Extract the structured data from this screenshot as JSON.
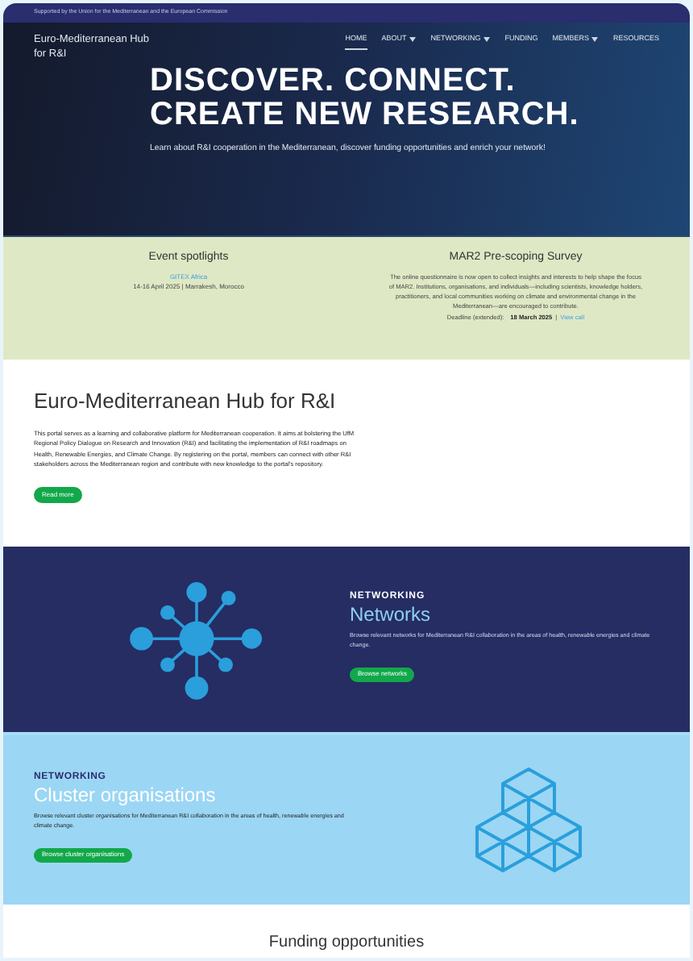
{
  "top_bar": {
    "text": "Supported by the Union for the Mediterranean and the European Commission"
  },
  "header": {
    "logo": "Euro-Mediterranean Hub for R&I",
    "nav": [
      {
        "label": "HOME",
        "selected": true,
        "dropdown": false
      },
      {
        "label": "ABOUT",
        "selected": false,
        "dropdown": true
      },
      {
        "label": "NETWORKING",
        "selected": false,
        "dropdown": true
      },
      {
        "label": "FUNDING",
        "selected": false,
        "dropdown": false
      },
      {
        "label": "MEMBERS",
        "selected": false,
        "dropdown": true
      },
      {
        "label": "RESOURCES",
        "selected": false,
        "dropdown": false
      }
    ]
  },
  "hero": {
    "title_lines": [
      "DISCOVER. CONNECT.",
      "CREATE NEW RESEARCH."
    ],
    "subtitle": "Learn about R&I cooperation in the Mediterranean, discover funding opportunities and enrich your network!"
  },
  "events": {
    "title": "Event spotlights",
    "link": "GITEX Africa",
    "details": "14-16 April 2025 | Marrakesh, Morocco"
  },
  "survey": {
    "title": "MAR2 Pre-scoping Survey",
    "body": "The online questionnaire is now open to collect insights and interests to help shape the focus of MAR2. Institutions, organisations, and individuals—including scientists, knowledge holders, practitioners, and local communities working on climate and environmental change in the Mediterranean—are encouraged to contribute.",
    "deadline_label": "Deadline (extended):",
    "deadline_date": "18 March 2025",
    "separator": "|",
    "link": "View call"
  },
  "about": {
    "title": "Euro-Mediterranean Hub for R&I",
    "body": "This portal serves as a learning and collaborative platform for Mediterranean cooperation. It aims at bolstering the UfM Regional Policy Dialogue on Research and Innovation (R&I) and facilitating the implementation of R&I roadmaps on Health, Renewable Energies, and Climate Change. By registering on the portal, members can connect with other R&I stakeholders across the Mediterranean region and contribute with new knowledge to the portal's repository.",
    "button": "Read more"
  },
  "networks": {
    "kicker": "NETWORKING",
    "title": "Networks",
    "body": "Browse relevant networks for Mediterranean R&I collaboration in the areas of health, renewable energies and climate change.",
    "button": "Browse networks"
  },
  "clusters": {
    "kicker": "NETWORKING",
    "title": "Cluster organisations",
    "body": "Browse relevant cluster organisations for Mediterranean R&I collaboration in the areas of health, renewable energies and climate change.",
    "button": "Browse cluster organisations"
  },
  "funding": {
    "title": "Funding opportunities"
  }
}
